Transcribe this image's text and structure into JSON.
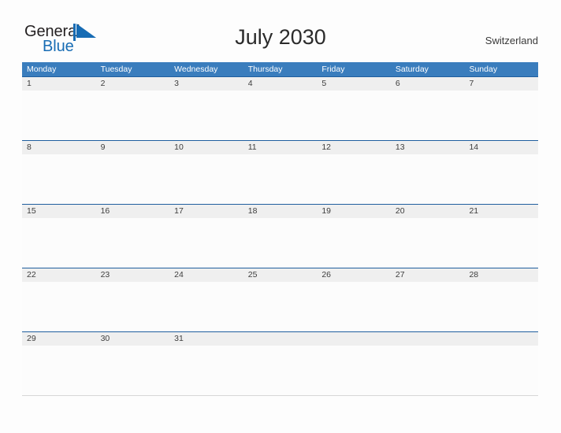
{
  "brand": {
    "word_one": "General",
    "word_two": "Blue",
    "flag_icon": "blue-pennant-triangle",
    "color_dark": "#231f20",
    "color_blue": "#176cb4"
  },
  "header": {
    "title": "July 2030",
    "region": "Switzerland"
  },
  "calendar": {
    "month": "July",
    "year": "2030",
    "week_start": "Monday",
    "header_color": "#3a7dbd",
    "date_band_color": "#efefef",
    "row_divider_color": "#1f5e9e",
    "weekdays": [
      "Monday",
      "Tuesday",
      "Wednesday",
      "Thursday",
      "Friday",
      "Saturday",
      "Sunday"
    ],
    "weeks": [
      [
        "1",
        "2",
        "3",
        "4",
        "5",
        "6",
        "7"
      ],
      [
        "8",
        "9",
        "10",
        "11",
        "12",
        "13",
        "14"
      ],
      [
        "15",
        "16",
        "17",
        "18",
        "19",
        "20",
        "21"
      ],
      [
        "22",
        "23",
        "24",
        "25",
        "26",
        "27",
        "28"
      ],
      [
        "29",
        "30",
        "31",
        "",
        "",
        "",
        ""
      ]
    ]
  }
}
